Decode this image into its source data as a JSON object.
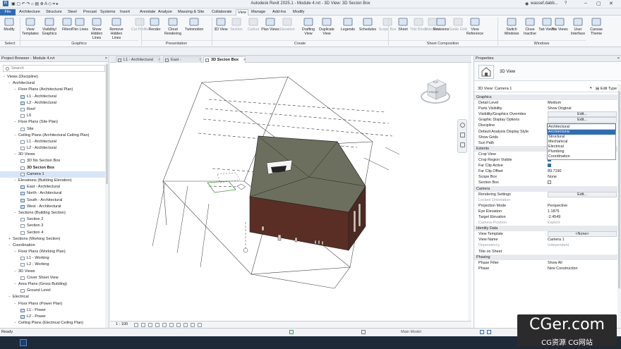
{
  "titlebar": {
    "title": "Autodesk Revit 2025.1 - Module 4.rvt - 3D View: 3D Secion Box",
    "user": "wassef.dabb...",
    "help": "?"
  },
  "menu": {
    "tabs": [
      "File",
      "Architecture",
      "Structure",
      "Steel",
      "Precast",
      "Systems",
      "Insert",
      "Annotate",
      "Analyze",
      "Massing & Site",
      "Collaborate",
      "View",
      "Manage",
      "Add-Ins",
      "Modify"
    ],
    "active": "View"
  },
  "ribbon": {
    "buttons": [
      {
        "label": "Modify"
      },
      {
        "label": "View Templates"
      },
      {
        "label": "Visibility/ Graphics"
      },
      {
        "label": "Filters"
      },
      {
        "label": "Thin Lines"
      },
      {
        "label": "Show Hidden Lines"
      },
      {
        "label": "Remove Hidden Lines"
      },
      {
        "label": "Cut Profile"
      },
      {
        "label": "Render"
      },
      {
        "label": "Cloud Rendering"
      },
      {
        "label": "Twinmotion"
      },
      {
        "label": "3D View"
      },
      {
        "label": "Section"
      },
      {
        "label": "Callout"
      },
      {
        "label": "Plan Views"
      },
      {
        "label": "Elevation"
      },
      {
        "label": "Drafting View"
      },
      {
        "label": "Duplicate View"
      },
      {
        "label": "Legends"
      },
      {
        "label": "Schedules"
      },
      {
        "label": "Scope Box"
      },
      {
        "label": "Sheet"
      },
      {
        "label": "Title Block"
      },
      {
        "label": "Matchline"
      },
      {
        "label": "Revisions"
      },
      {
        "label": "Guide Grid"
      },
      {
        "label": "View Reference"
      },
      {
        "label": "Switch Windows"
      },
      {
        "label": "Close Inactive"
      },
      {
        "label": "Tab Views"
      },
      {
        "label": "Tile Views"
      },
      {
        "label": "User Interface"
      },
      {
        "label": "Canvas Theme"
      }
    ],
    "groups": [
      "Select",
      "Graphics",
      "Presentation",
      "Create",
      "Sheet Composition",
      "Windows"
    ]
  },
  "browser": {
    "title": "Project Browser - Module 4.rvt",
    "close": "×",
    "search_placeholder": "Search",
    "items": [
      {
        "label": "Views (Discipline)",
        "level": 0,
        "toggle": "−"
      },
      {
        "label": "Architectural",
        "level": 1,
        "toggle": "−"
      },
      {
        "label": "Floor Plans (Architectural Plan)",
        "level": 2,
        "toggle": "−"
      },
      {
        "label": "L1 - Architectural",
        "level": 3,
        "icon": "plan"
      },
      {
        "label": "L2 - Architectural",
        "level": 3,
        "icon": "plan"
      },
      {
        "label": "Roof",
        "level": 3,
        "icon": "plan-empty"
      },
      {
        "label": "L6",
        "level": 3,
        "icon": "plan-empty"
      },
      {
        "label": "Floor Plans (Site Plan)",
        "level": 2,
        "toggle": "−"
      },
      {
        "label": "Site",
        "level": 3,
        "icon": "plan-empty"
      },
      {
        "label": "Ceiling Plans (Architectural Ceiling Plan)",
        "level": 2,
        "toggle": "−"
      },
      {
        "label": "L1 - Architectural",
        "level": 3,
        "icon": "plan-empty"
      },
      {
        "label": "L2 - Architectural",
        "level": 3,
        "icon": "plan-empty"
      },
      {
        "label": "3D Views",
        "level": 2,
        "toggle": "−"
      },
      {
        "label": "3D No Section Box",
        "level": 3,
        "icon": "plan-empty"
      },
      {
        "label": "3D Secion Box",
        "level": 3,
        "icon": "plan-empty",
        "bold": true
      },
      {
        "label": "Camera 1",
        "level": 3,
        "icon": "plan-empty",
        "selected": true
      },
      {
        "label": "Elevations (Building Elevation)",
        "level": 2,
        "toggle": "−"
      },
      {
        "label": "East - Architectural",
        "level": 3,
        "icon": "plan"
      },
      {
        "label": "North - Architectural",
        "level": 3,
        "icon": "plan"
      },
      {
        "label": "South - Architectural",
        "level": 3,
        "icon": "plan"
      },
      {
        "label": "West - Architectural",
        "level": 3,
        "icon": "plan"
      },
      {
        "label": "Sections (Building Section)",
        "level": 2,
        "toggle": "−"
      },
      {
        "label": "Section 2",
        "level": 3,
        "icon": "plan-empty"
      },
      {
        "label": "Section 3",
        "level": 3,
        "icon": "plan-empty"
      },
      {
        "label": "Section 4",
        "level": 3,
        "icon": "plan-empty"
      },
      {
        "label": "Sections (Working Section)",
        "level": 1,
        "toggle": "+"
      },
      {
        "label": "Coordination",
        "level": 1,
        "toggle": "−"
      },
      {
        "label": "Floor Plans (Working Plan)",
        "level": 2,
        "toggle": "−"
      },
      {
        "label": "L1 - Working",
        "level": 3,
        "icon": "plan-empty"
      },
      {
        "label": "L2 - Working",
        "level": 3,
        "icon": "plan-empty"
      },
      {
        "label": "3D Views",
        "level": 2,
        "toggle": "−"
      },
      {
        "label": "Cover Sheet View",
        "level": 3,
        "icon": "plan-empty"
      },
      {
        "label": "Area Plans (Gross Building)",
        "level": 2,
        "toggle": "−"
      },
      {
        "label": "Ground Level",
        "level": 3,
        "icon": "plan-empty"
      },
      {
        "label": "Electrical",
        "level": 1,
        "toggle": "−"
      },
      {
        "label": "Floor Plans (Power Plan)",
        "level": 2,
        "toggle": "−"
      },
      {
        "label": "L1 - Power",
        "level": 3,
        "icon": "plan"
      },
      {
        "label": "L2 - Power",
        "level": 3,
        "icon": "plan"
      },
      {
        "label": "Ceiling Plans (Electrical Ceiling Plan)",
        "level": 2,
        "toggle": "−"
      }
    ]
  },
  "view_tabs": [
    {
      "label": "L1 - Architectural",
      "active": false
    },
    {
      "label": "East - Architectural",
      "active": false
    },
    {
      "label": "3D Secion Box",
      "active": true
    }
  ],
  "viewcube": {
    "top": "TOP",
    "front": "FRONT"
  },
  "view_control": {
    "scale": "1 : 100"
  },
  "properties": {
    "title": "Properties",
    "close": "×",
    "type_name": "3D View",
    "instance_selector": "3D View: Camera 1",
    "edit_type": "Edit Type",
    "rows": [
      {
        "kind": "section",
        "label": "Graphics"
      },
      {
        "label": "Detail Level",
        "value": "Medium"
      },
      {
        "label": "Parts Visibility",
        "value": "Show Original"
      },
      {
        "label": "Visibility/Graphics Overrides",
        "value": "Edit...",
        "button": true
      },
      {
        "label": "Graphic Display Options",
        "value": "Edit...",
        "button": true
      },
      {
        "label": "Discipline",
        "value": "Architectural"
      },
      {
        "label": "Default Analysis Display Style",
        "value": ""
      },
      {
        "label": "Show Grids",
        "value": ""
      },
      {
        "label": "Sun Path",
        "value": ""
      },
      {
        "kind": "section",
        "label": "Extents"
      },
      {
        "label": "Crop View",
        "value": ""
      },
      {
        "label": "Crop Region Visible",
        "check": true
      },
      {
        "label": "Far Clip Active",
        "check": true
      },
      {
        "label": "Far Clip Offset",
        "value": "89.7190"
      },
      {
        "label": "Scope Box",
        "value": "None"
      },
      {
        "label": "Section Box",
        "check": false
      },
      {
        "kind": "section",
        "label": "Camera"
      },
      {
        "label": "Rendering Settings",
        "value": "Edit...",
        "button": true
      },
      {
        "label": "Locked Orientation",
        "value": "",
        "gray": true
      },
      {
        "label": "Projection Mode",
        "value": "Perspective"
      },
      {
        "label": "Eye Elevation",
        "value": "1.1875"
      },
      {
        "label": "Target Elevation",
        "value": "-2.4549"
      },
      {
        "label": "Camera Position",
        "value": "Explicit",
        "gray": true
      },
      {
        "kind": "section",
        "label": "Identity Data"
      },
      {
        "label": "View Template",
        "value": "<None>",
        "button": true
      },
      {
        "label": "View Name",
        "value": "Camera 1"
      },
      {
        "label": "Dependency",
        "value": "Independent",
        "gray": true
      },
      {
        "label": "Title on Sheet",
        "value": ""
      },
      {
        "kind": "section",
        "label": "Phasing"
      },
      {
        "label": "Phase Filter",
        "value": "Show All"
      },
      {
        "label": "Phase",
        "value": "New Construction"
      }
    ],
    "discipline_dropdown": {
      "current": "Architectural",
      "options": [
        "Architectural",
        "Structural",
        "Mechanical",
        "Electrical",
        "Plumbing",
        "Coordination"
      ],
      "highlighted": "Architectural"
    }
  },
  "status": {
    "text": "Ready",
    "model": "Main Model"
  },
  "watermark": {
    "big": "CGer.com",
    "small": "CG资源 CG网站"
  }
}
